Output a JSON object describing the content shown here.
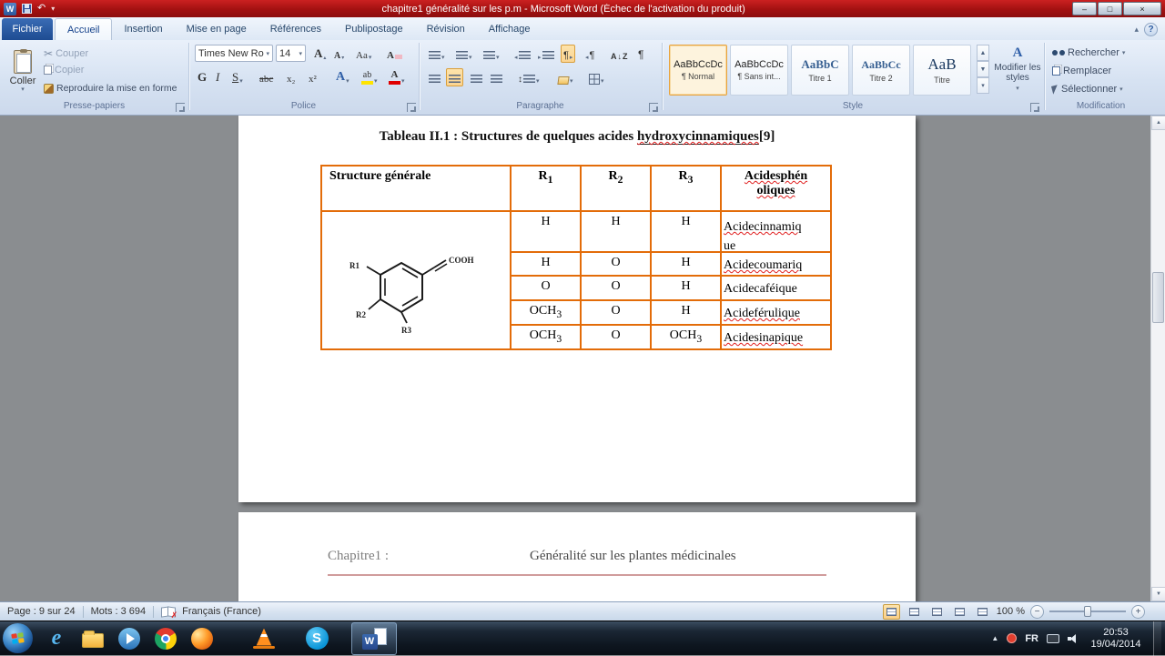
{
  "icons": {
    "dropdown": "▾",
    "chevron_up": "▴",
    "scroll_up": "▲",
    "scroll_down": "▼",
    "tri_left": "◂",
    "tri_right": "▸",
    "updown": "↕",
    "pilcrow": "¶",
    "down_small": "↓",
    "undo": "↶",
    "cut": "✂",
    "help": "?",
    "minimize": "–",
    "maximize": "□",
    "close": "×",
    "proof_x": "✗",
    "tray_expand": "▲"
  },
  "letters": {
    "app": "W",
    "ie": "e",
    "skype": "S",
    "word": "W"
  },
  "titlebar": {
    "title": "chapitre1 généralité sur les p.m  -  Microsoft Word (Échec de l'activation du produit)"
  },
  "ribbon": {
    "file_tab": "Fichier",
    "tabs": [
      "Accueil",
      "Insertion",
      "Mise en page",
      "Références",
      "Publipostage",
      "Révision",
      "Affichage"
    ],
    "clipboard": {
      "label": "Presse-papiers",
      "paste": "Coller",
      "cut": "Couper",
      "copy": "Copier",
      "format_painter": "Reproduire la mise en forme"
    },
    "font": {
      "label": "Police",
      "name": "Times New Ro",
      "size": "14",
      "grow": "A",
      "shrink": "A",
      "case_btn": "Aa",
      "bold": "G",
      "italic": "I",
      "underline": "S",
      "strike": "abc",
      "subscript": "x₂",
      "superscript": "x²",
      "effects": "A",
      "highlight": "ab",
      "color": "A"
    },
    "paragraph": {
      "label": "Paragraphe",
      "sort_a": "A",
      "sort_z": "Z"
    },
    "styles": {
      "label": "Style",
      "items": [
        {
          "preview": "AaBbCcDc",
          "name": "¶ Normal"
        },
        {
          "preview": "AaBbCcDc",
          "name": "¶ Sans int..."
        },
        {
          "preview": "AaBbC",
          "name": "Titre 1"
        },
        {
          "preview": "AaBbCc",
          "name": "Titre 2"
        },
        {
          "preview": "AaB",
          "name": "Titre"
        }
      ],
      "change": "Modifier les styles"
    },
    "editing": {
      "label": "Modification",
      "find": "Rechercher",
      "replace": "Remplacer",
      "select": "Sélectionner"
    }
  },
  "document": {
    "caption": {
      "prefix": "Tableau II.1 : Structures de quelques acides ",
      "word": "hydroxycinnamiques",
      "ref": "[9]"
    },
    "table": {
      "h_structure": "Structure  générale",
      "h_r1": {
        "t": "R",
        "s": "1"
      },
      "h_r2": {
        "t": "R",
        "s": "2"
      },
      "h_r3": {
        "t": "R",
        "s": "3"
      },
      "h_acids1": "Acidesphén",
      "h_acids2": "oliques",
      "rows": [
        {
          "c1": {
            "t": "H",
            "s": ""
          },
          "c2": {
            "t": "H",
            "s": ""
          },
          "c3": {
            "t": "H",
            "s": ""
          },
          "n1": "Acidecinnamiq",
          "n2": "ue"
        },
        {
          "c1": {
            "t": "H",
            "s": ""
          },
          "c2": {
            "t": "O",
            "s": ""
          },
          "c3": {
            "t": "H",
            "s": ""
          },
          "n1": "Acidecoumariq",
          "n2": ""
        },
        {
          "c1": {
            "t": "O",
            "s": ""
          },
          "c2": {
            "t": "O",
            "s": ""
          },
          "c3": {
            "t": "H",
            "s": ""
          },
          "n1": "Acidecaféique",
          "n2": ""
        },
        {
          "c1": {
            "t": "OCH",
            "s": "3"
          },
          "c2": {
            "t": "O",
            "s": ""
          },
          "c3": {
            "t": "H",
            "s": ""
          },
          "n1": "Acideférulique",
          "n2": ""
        },
        {
          "c1": {
            "t": "OCH",
            "s": "3"
          },
          "c2": {
            "t": "O",
            "s": ""
          },
          "c3": {
            "t": "OCH",
            "s": "3"
          },
          "n1": "Acidesinapique",
          "n2": ""
        }
      ]
    },
    "structure": {
      "r1": "R1",
      "r2": "R2",
      "r3": "R3",
      "cooh": "COOH"
    },
    "page2": {
      "chapter": "Chapitre1 :",
      "title": "Généralité sur les plantes médicinales"
    }
  },
  "statusbar": {
    "page": "Page : 9 sur 24",
    "words": "Mots : 3 694",
    "language": "Français (France)",
    "zoom": "100 %",
    "minus": "−",
    "plus": "+"
  },
  "taskbar": {
    "lang": "FR",
    "time": "20:53",
    "date": "19/04/2014"
  }
}
